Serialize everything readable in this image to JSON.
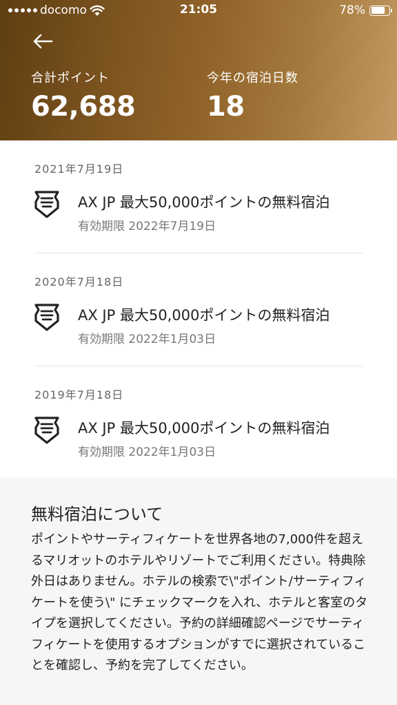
{
  "status_bar": {
    "carrier": "docomo",
    "time": "21:05",
    "battery": "78%",
    "battery_level": 0.78
  },
  "header": {
    "total_points_label": "合計ポイント",
    "total_points_value": "62,688",
    "nights_label": "今年の宿泊日数",
    "nights_value": "18"
  },
  "certificates": [
    {
      "date": "2021年7月19日",
      "title": "AX JP 最大50,000ポイントの無料宿泊",
      "expiry": "有効期限 2022年7月19日"
    },
    {
      "date": "2020年7月18日",
      "title": "AX JP 最大50,000ポイントの無料宿泊",
      "expiry": "有効期限 2022年1月03日"
    },
    {
      "date": "2019年7月18日",
      "title": "AX JP 最大50,000ポイントの無料宿泊",
      "expiry": "有効期限 2022年1月03日"
    }
  ],
  "about": {
    "title": "無料宿泊について",
    "body": "ポイントやサーティフィケートを世界各地の7,000件を超えるマリオットのホテルやリゾートでご利用ください。特典除外日はありません。ホテルの検索で\\\"ポイント/サーティフィケートを使う\\\" にチェックマークを入れ、ホテルと客室のタイプを選択してください。予約の詳細確認ページでサーティフィケートを使用するオプションがすでに選択されていることを確認し、予約を完了してください。"
  }
}
